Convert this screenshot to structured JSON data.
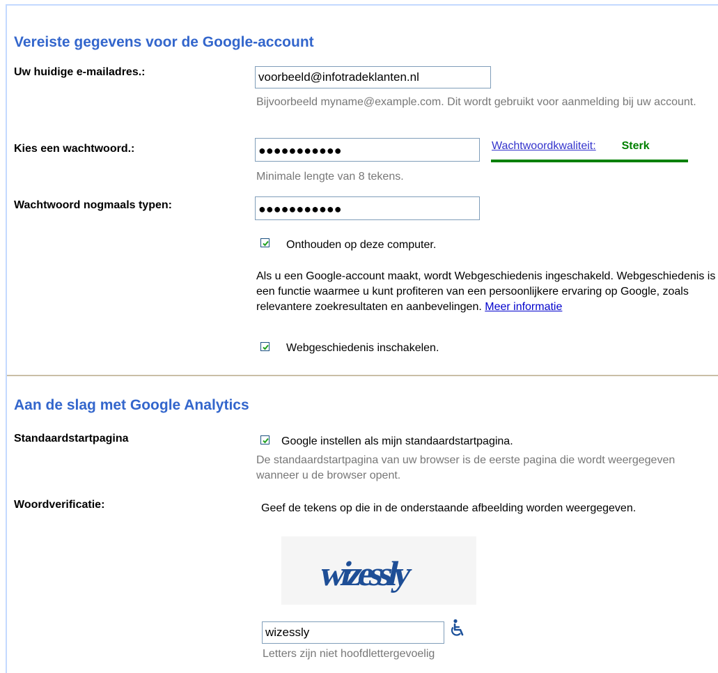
{
  "required": {
    "title": "Vereiste gegevens voor de Google-account",
    "email_label": "Uw huidige e-mailadres.:",
    "email_value": "voorbeeld@infotradeklanten.nl",
    "email_hint": "Bijvoorbeeld myname@example.com. Dit wordt gebruikt voor aanmelding bij uw account.",
    "password_label": "Kies een wachtwoord.:",
    "password_value": "●●●●●●●●●●●",
    "password_hint": "Minimale lengte van 8 tekens.",
    "strength_link": "Wachtwoordkwaliteit:",
    "strength_value": "Sterk",
    "strength_color": "#008000",
    "confirm_label": "Wachtwoord nogmaals typen:",
    "confirm_value": "●●●●●●●●●●●",
    "remember_label": "Onthouden op deze computer.",
    "remember_checked": true,
    "history_text": "Als u een Google-account maakt, wordt Webgeschiedenis ingeschakeld. Webgeschiedenis is een functie waarmee u kunt profiteren van een persoonlijkere ervaring op Google, zoals relevantere zoekresultaten en aanbevelingen.",
    "history_link": "Meer informatie",
    "history_checkbox_label": "Webgeschiedenis inschakelen.",
    "history_checked": true
  },
  "analytics": {
    "title": "Aan de slag met Google Analytics",
    "homepage_label": "Standaardstartpagina",
    "homepage_checkbox_label": "Google instellen als mijn standaardstartpagina.",
    "homepage_checked": true,
    "homepage_hint": "De standaardstartpagina van uw browser is de eerste pagina die wordt weergegeven wanneer u de browser opent.",
    "verify_label": "Woordverificatie:",
    "verify_instructions": "Geef de tekens op die in de onderstaande afbeelding worden weergegeven.",
    "captcha_text": "wizessly",
    "captcha_input_value": "wizessly",
    "captcha_hint": "Letters zijn niet hoofdlettergevoelig",
    "accessibility_icon": "wheelchair-icon"
  },
  "colors": {
    "section_title": "#3366cc",
    "hint_text": "#777777",
    "divider": "#c9bea6",
    "frame_border": "#c3d9ff"
  }
}
